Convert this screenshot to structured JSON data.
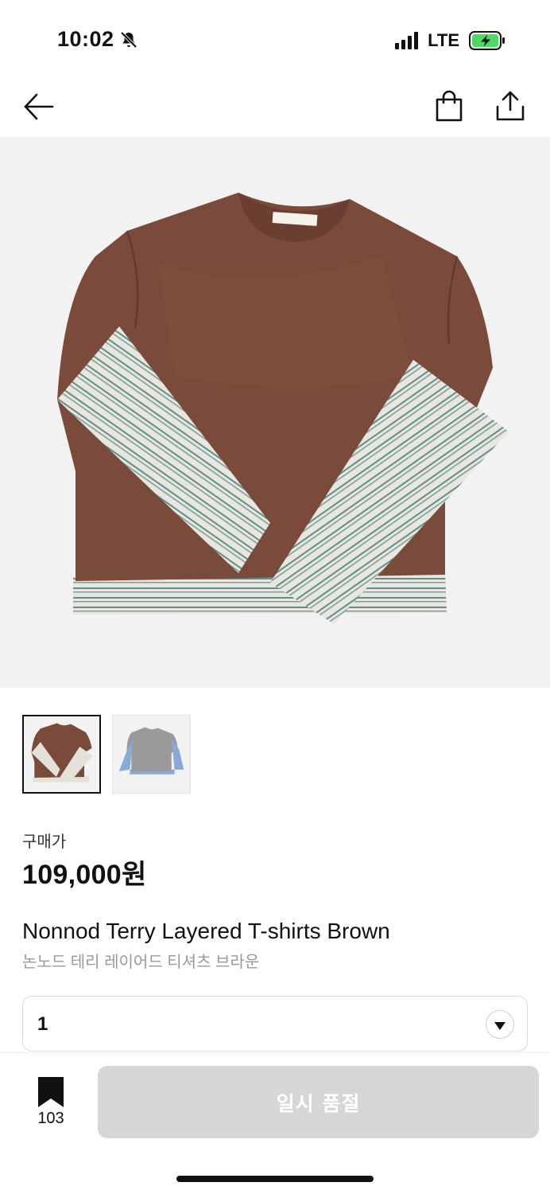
{
  "status_bar": {
    "time": "10:02",
    "network": "LTE",
    "icons": [
      "bell-slash-icon",
      "signal-icon",
      "battery-charging-icon"
    ],
    "battery_color": "#4cd964"
  },
  "nav": {
    "icons": [
      "arrow-left-icon",
      "shopping-bag-icon",
      "share-icon"
    ]
  },
  "product_images": {
    "main": "brown-layered-tshirt",
    "thumbnails": [
      {
        "name": "brown-layered-tshirt",
        "selected": true
      },
      {
        "name": "gray-layered-tshirt",
        "selected": false
      }
    ]
  },
  "price": {
    "label": "구매가",
    "value": "109,000원"
  },
  "product": {
    "name": "Nonnod Terry Layered T-shirts Brown",
    "name_ko": "논노드 테리 레이어드 티셔츠 브라운"
  },
  "quantity": {
    "value": "1"
  },
  "bottom": {
    "bookmark_count": "103",
    "soldout_label": "일시 품절",
    "button_color": "#d6d6d6"
  },
  "colors": {
    "shirt_brown": "#7a4a3a",
    "stripe_cream": "#e8e6df",
    "stripe_teal": "#5f8f88"
  }
}
